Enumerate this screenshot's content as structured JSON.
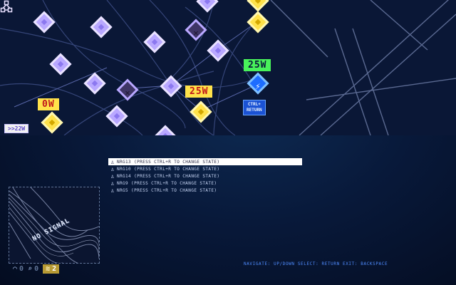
{
  "map": {
    "labels": {
      "watt_top": "",
      "watt_left": "0W",
      "watt_mid": "25W",
      "watt_right": "25W",
      "ctrl_hint_line1": "CTRL+",
      "ctrl_hint_line2": "RETURN",
      "edge_tag": ">>22W"
    }
  },
  "menu": {
    "items": [
      {
        "label": "NRG13 (PRESS CTRL+R TO CHANGE STATE)",
        "selected": true
      },
      {
        "label": "NRG10 (PRESS CTRL+R TO CHANGE STATE)",
        "selected": false
      },
      {
        "label": "NRG14 (PRESS CTRL+R TO CHANGE STATE)",
        "selected": false
      },
      {
        "label": "NRG9 (PRESS CTRL+R TO CHANGE STATE)",
        "selected": false
      },
      {
        "label": "NRG5 (PRESS CTRL+R TO CHANGE STATE)",
        "selected": false
      }
    ]
  },
  "minimap": {
    "label": "NO SIGNAL"
  },
  "stats": {
    "wifi": {
      "icon": "wifi-icon",
      "value": "0"
    },
    "search": {
      "icon": "search-icon",
      "value": "0"
    },
    "energy": {
      "icon": "energy-icon",
      "value": "2"
    }
  },
  "footer": {
    "hint": "NAVIGATE: UP/DOWN   SELECT: RETURN   EXIT: BACKSPACE"
  },
  "colors": {
    "node_purple": "#b9a8ff",
    "node_yellow": "#ffe24a",
    "watt_green": "#48f25a",
    "accent_blue": "#4f8cff"
  }
}
